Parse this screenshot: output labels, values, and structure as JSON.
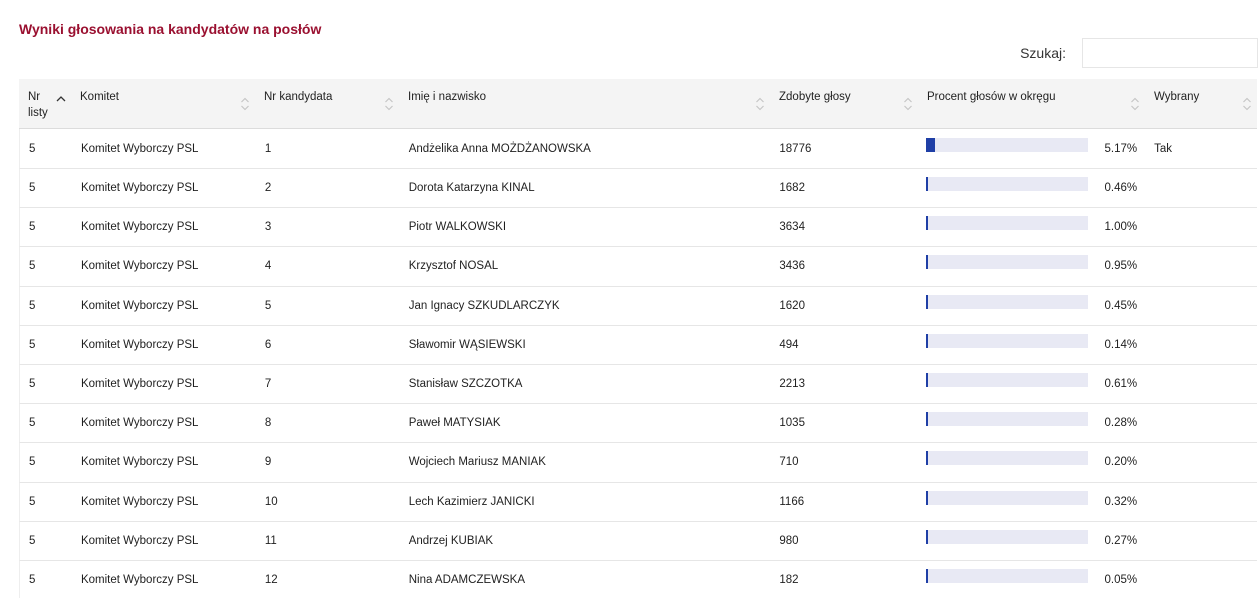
{
  "title": "Wyniki głosowania na kandydatów na posłów",
  "search": {
    "label": "Szukaj:",
    "value": ""
  },
  "columns": [
    {
      "label": "Nr listy",
      "sort": "ascending"
    },
    {
      "label": "Komitet",
      "sort": "none"
    },
    {
      "label": "Nr kandydata",
      "sort": "none"
    },
    {
      "label": "Imię i nazwisko",
      "sort": "none"
    },
    {
      "label": "Zdobyte głosy",
      "sort": "none"
    },
    {
      "label": "Procent głosów w okręgu",
      "sort": "none"
    },
    {
      "label": "Wybrany",
      "sort": "none"
    }
  ],
  "colors": {
    "title": "#9a1030",
    "bar_fill": "#1f3fa6",
    "bar_track": "#e8e9f4"
  },
  "rows": [
    {
      "list": "5",
      "committee": "Komitet Wyborczy PSL",
      "number": "1",
      "name": "Andżelika Anna MOŻDŻANOWSKA",
      "votes": "18776",
      "percent_label": "5.17%",
      "percent": 5.17,
      "elected": "Tak"
    },
    {
      "list": "5",
      "committee": "Komitet Wyborczy PSL",
      "number": "2",
      "name": "Dorota Katarzyna KINAL",
      "votes": "1682",
      "percent_label": "0.46%",
      "percent": 0.46,
      "elected": ""
    },
    {
      "list": "5",
      "committee": "Komitet Wyborczy PSL",
      "number": "3",
      "name": "Piotr WALKOWSKI",
      "votes": "3634",
      "percent_label": "1.00%",
      "percent": 1.0,
      "elected": ""
    },
    {
      "list": "5",
      "committee": "Komitet Wyborczy PSL",
      "number": "4",
      "name": "Krzysztof NOSAL",
      "votes": "3436",
      "percent_label": "0.95%",
      "percent": 0.95,
      "elected": ""
    },
    {
      "list": "5",
      "committee": "Komitet Wyborczy PSL",
      "number": "5",
      "name": "Jan Ignacy SZKUDLARCZYK",
      "votes": "1620",
      "percent_label": "0.45%",
      "percent": 0.45,
      "elected": ""
    },
    {
      "list": "5",
      "committee": "Komitet Wyborczy PSL",
      "number": "6",
      "name": "Sławomir WĄSIEWSKI",
      "votes": "494",
      "percent_label": "0.14%",
      "percent": 0.14,
      "elected": ""
    },
    {
      "list": "5",
      "committee": "Komitet Wyborczy PSL",
      "number": "7",
      "name": "Stanisław SZCZOTKA",
      "votes": "2213",
      "percent_label": "0.61%",
      "percent": 0.61,
      "elected": ""
    },
    {
      "list": "5",
      "committee": "Komitet Wyborczy PSL",
      "number": "8",
      "name": "Paweł MATYSIAK",
      "votes": "1035",
      "percent_label": "0.28%",
      "percent": 0.28,
      "elected": ""
    },
    {
      "list": "5",
      "committee": "Komitet Wyborczy PSL",
      "number": "9",
      "name": "Wojciech Mariusz MANIAK",
      "votes": "710",
      "percent_label": "0.20%",
      "percent": 0.2,
      "elected": ""
    },
    {
      "list": "5",
      "committee": "Komitet Wyborczy PSL",
      "number": "10",
      "name": "Lech Kazimierz JANICKI",
      "votes": "1166",
      "percent_label": "0.32%",
      "percent": 0.32,
      "elected": ""
    },
    {
      "list": "5",
      "committee": "Komitet Wyborczy PSL",
      "number": "11",
      "name": "Andrzej KUBIAK",
      "votes": "980",
      "percent_label": "0.27%",
      "percent": 0.27,
      "elected": ""
    },
    {
      "list": "5",
      "committee": "Komitet Wyborczy PSL",
      "number": "12",
      "name": "Nina ADAMCZEWSKA",
      "votes": "182",
      "percent_label": "0.05%",
      "percent": 0.05,
      "elected": ""
    }
  ]
}
